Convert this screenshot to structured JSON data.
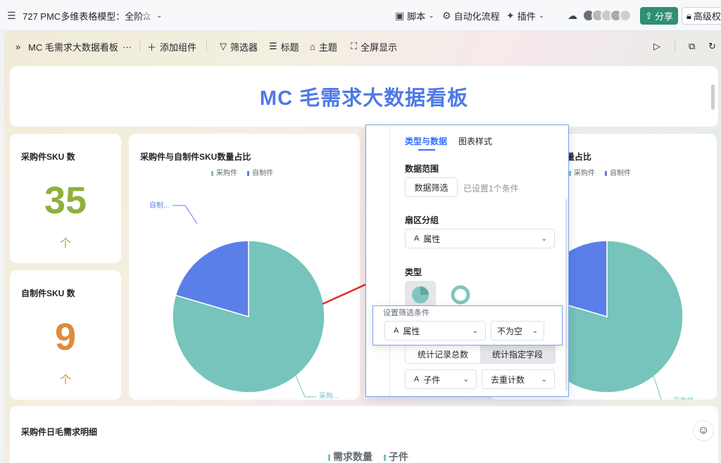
{
  "topbar": {
    "title": "727 PMC多维表格模型：全阶...",
    "script_label": "脚本",
    "automation_label": "自动化流程",
    "plugin_label": "插件",
    "share_label": "分享",
    "advanced_label": "高级权"
  },
  "toolbar": {
    "dashboard_name": "MC 毛需求大数据看板",
    "more": "···",
    "add_widget": "添加组件",
    "filter": "筛选器",
    "title": "标题",
    "theme": "主题",
    "fullscreen": "全屏显示"
  },
  "dashboard": {
    "main_title": "MC 毛需求大数据看板"
  },
  "kpi": [
    {
      "title": "采购件SKU 数",
      "value": "35",
      "unit": "个",
      "color": "#8fb03a"
    },
    {
      "title": "自制件SKU 数",
      "value": "9",
      "unit": "个",
      "color": "#e08a3c"
    }
  ],
  "pie_card": {
    "title": "采购件与自制件SKU数量占比",
    "legend": [
      "采购件",
      "自制件"
    ],
    "slice_label_purchase": "采购...",
    "slice_label_self": "自制..."
  },
  "pie_card2": {
    "title_fragment": "量占比",
    "legend": [
      "采购件",
      "自制件"
    ],
    "slice_label_purchase": "采购件..."
  },
  "chart_data": {
    "type": "pie",
    "categories": [
      "采购件",
      "自制件"
    ],
    "values": [
      35,
      9
    ],
    "colors": [
      "#76c4bb",
      "#5b7fe9"
    ]
  },
  "panel": {
    "tab_type_data": "类型与数据",
    "tab_chart_style": "图表样式",
    "data_range_label": "数据范围",
    "data_filter_btn": "数据筛选",
    "filter_set_text": "已设置1个条件",
    "sector_group_label": "扇区分组",
    "sector_field": "属性",
    "type_label": "类型",
    "count_records": "统计记录总数",
    "count_field": "统计指定字段",
    "field_select": "子件",
    "agg_select": "去重计数"
  },
  "popup": {
    "title": "设置筛选条件",
    "field": "属性",
    "operator": "不为空"
  },
  "bottom": {
    "title": "采购件日毛需求明细",
    "legend": [
      "需求数量",
      "子件"
    ]
  }
}
